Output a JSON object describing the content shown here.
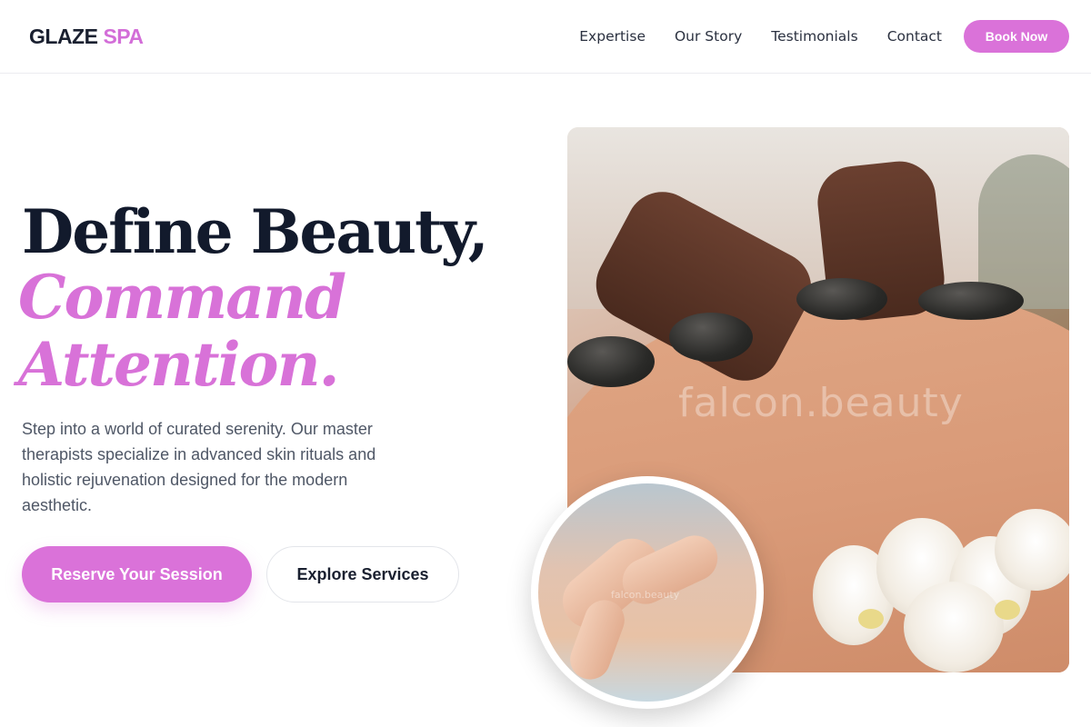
{
  "brand": {
    "name_part1": "GLAZE",
    "name_part2": "SPA",
    "accent_color": "#da72d9"
  },
  "nav": {
    "links": [
      "Expertise",
      "Our Story",
      "Testimonials",
      "Contact"
    ],
    "cta_label": "Book Now"
  },
  "hero": {
    "headline_line1": "Define Beauty,",
    "headline_line2": "Command",
    "headline_line3": "Attention.",
    "description": "Step into a world of curated serenity. Our master therapists specialize in advanced skin rituals and holistic rejuvenation designed for the modern aesthetic.",
    "primary_cta": "Reserve Your Session",
    "secondary_cta": "Explore Services",
    "image_watermark": "falcon.beauty",
    "inset_watermark": "falcon.beauty"
  }
}
